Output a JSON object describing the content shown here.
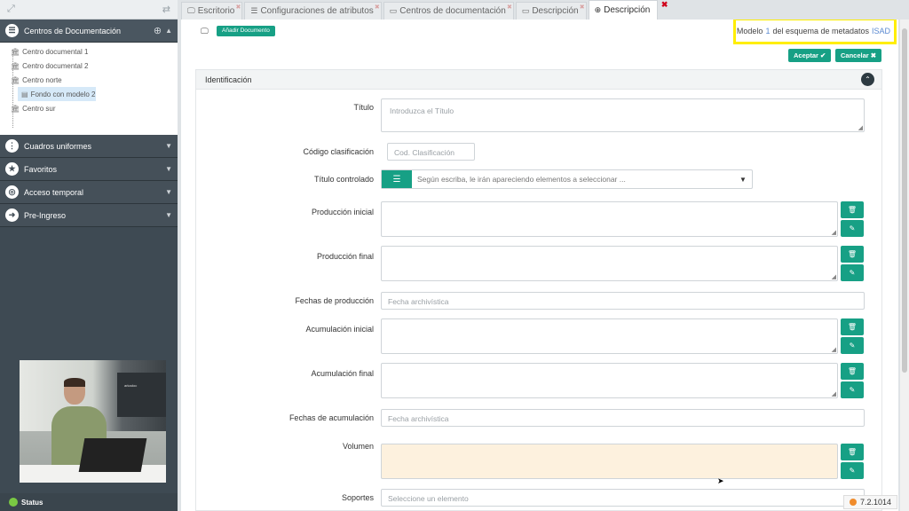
{
  "sidebar": {
    "sections": [
      {
        "label": "Centros de Documentación",
        "icon": "list-icon"
      },
      {
        "label": "Cuadros uniformes",
        "icon": "tree-icon"
      },
      {
        "label": "Favoritos",
        "icon": "star-icon"
      },
      {
        "label": "Acceso temporal",
        "icon": "circle-icon"
      },
      {
        "label": "Pre-Ingreso",
        "icon": "login-icon"
      }
    ],
    "tree": [
      "Centro documental 1",
      "Centro documental 2",
      "Centro norte",
      "Fondo con modelo 2",
      "Centro sur"
    ],
    "status_label": "Status"
  },
  "tabs": [
    {
      "label": "Escritorio"
    },
    {
      "label": "Configuraciones de atributos"
    },
    {
      "label": "Centros de documentación"
    },
    {
      "label": "Descripción"
    },
    {
      "label": "Descripción"
    }
  ],
  "header": {
    "badge": "Añadir Documento",
    "model_prefix": "Modelo",
    "model_number": "1",
    "model_middle": "del esquema de metadatos",
    "model_schema": "ISAD",
    "accept": "Aceptar",
    "cancel": "Cancelar"
  },
  "panel": {
    "title": "Identificación",
    "fields": {
      "titulo": {
        "label": "Título",
        "placeholder": "Introduzca el Título"
      },
      "codigo": {
        "label": "Código clasificación",
        "placeholder": "Cod. Clasificación"
      },
      "titulo_controlado": {
        "label": "Título controlado",
        "placeholder": "Según escriba, le irán apareciendo elementos a seleccionar ..."
      },
      "produccion_inicial": {
        "label": "Producción inicial"
      },
      "produccion_final": {
        "label": "Producción final"
      },
      "fechas_produccion": {
        "label": "Fechas de producción",
        "placeholder": "Fecha archivística"
      },
      "acumulacion_inicial": {
        "label": "Acumulación inicial"
      },
      "acumulacion_final": {
        "label": "Acumulación final"
      },
      "fechas_acumulacion": {
        "label": "Fechas de acumulación",
        "placeholder": "Fecha archivística"
      },
      "volumen": {
        "label": "Volumen"
      },
      "soportes": {
        "label": "Soportes",
        "placeholder": "Seleccione un elemento"
      }
    }
  },
  "video": {
    "screen_text": "arkadoc"
  },
  "version": "7.2.1014",
  "colors": {
    "accent": "#17a085",
    "sidebar": "#3e4a53",
    "highlight": "#ffee00"
  }
}
